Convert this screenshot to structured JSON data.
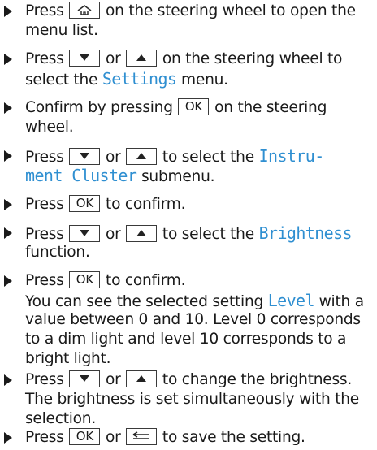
{
  "steps": [
    {
      "l1a": "Press",
      "l1b": "on the steering wheel to open the",
      "l2": "menu list."
    },
    {
      "l1a": "Press",
      "l1b": "or",
      "l1c": "on the steering wheel to",
      "l2a": "select the",
      "l2hl": "Settings",
      "l2b": "menu."
    },
    {
      "l1a": "Confirm by pressing",
      "l1b": "on the steering",
      "l2": "wheel."
    },
    {
      "l1a": "Press",
      "l1b": "or",
      "l1c": "to select the",
      "l1hl": "Instru-",
      "l2hl": "ment Cluster",
      "l2b": "submenu."
    },
    {
      "l1a": "Press",
      "l1b": "to confirm."
    },
    {
      "l1a": "Press",
      "l1b": "or",
      "l1c": "to select the",
      "l1hl": "Brightness",
      "l2": "function."
    },
    {
      "l1a": "Press",
      "l1b": "to confirm.",
      "l2a": "You can see the selected setting",
      "l2hl": "Level",
      "l2b": "with a",
      "l3": "value between 0 and 10. Level 0 corresponds",
      "l4": "to a dim light and level 10 corresponds to a",
      "l5": "bright light."
    },
    {
      "l1a": "Press",
      "l1b": "or",
      "l1c": "to change the brightness.",
      "l2": "The brightness is set simultaneously with the",
      "l3": "selection."
    },
    {
      "l1a": "Press",
      "l1b": "or",
      "l1c": "to save the setting."
    }
  ],
  "keys": {
    "ok": "OK"
  },
  "icons": {
    "home": "home-icon",
    "down": "arrow-down-icon",
    "up": "arrow-up-icon",
    "back": "back-icon"
  },
  "colors": {
    "highlight": "#2f8fd1",
    "text": "#1a1a1a"
  }
}
